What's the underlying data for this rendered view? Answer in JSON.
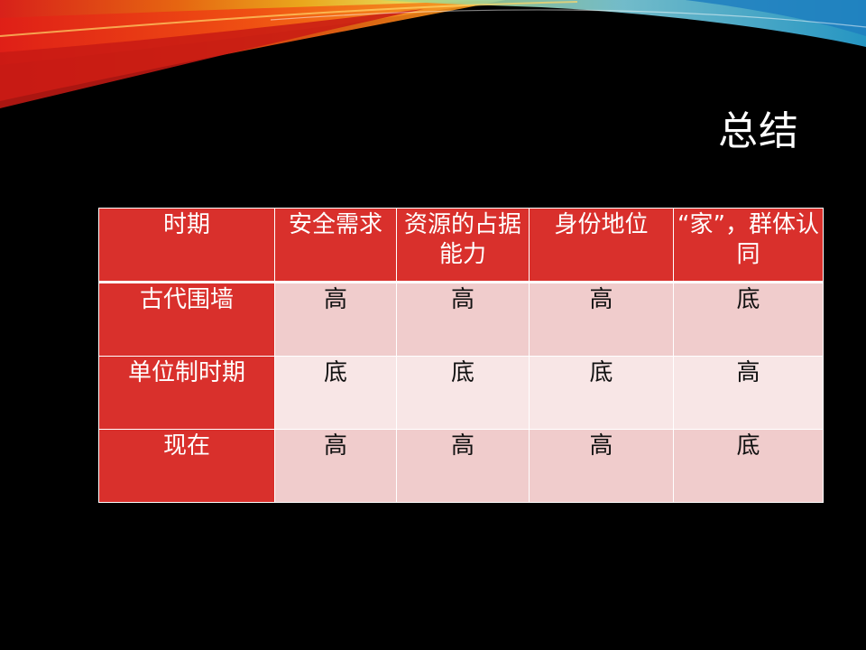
{
  "slide": {
    "title": "总结"
  },
  "table": {
    "headers": [
      "时期",
      "安全需求",
      "资源的占据能力",
      "身份地位",
      "“家”，群体认同"
    ],
    "rows": [
      {
        "label": "古代围墙",
        "values": [
          "高",
          "高",
          "高",
          "底"
        ]
      },
      {
        "label": "单位制时期",
        "values": [
          "底",
          "底",
          "底",
          "高"
        ]
      },
      {
        "label": "现在",
        "values": [
          "高",
          "高",
          "高",
          "底"
        ]
      }
    ]
  },
  "colors": {
    "background": "#000000",
    "header_fill": "#d9302c",
    "cell_fill_odd": "#f0cccc",
    "cell_fill_even": "#f8e6e6",
    "title_text": "#ffffff"
  }
}
